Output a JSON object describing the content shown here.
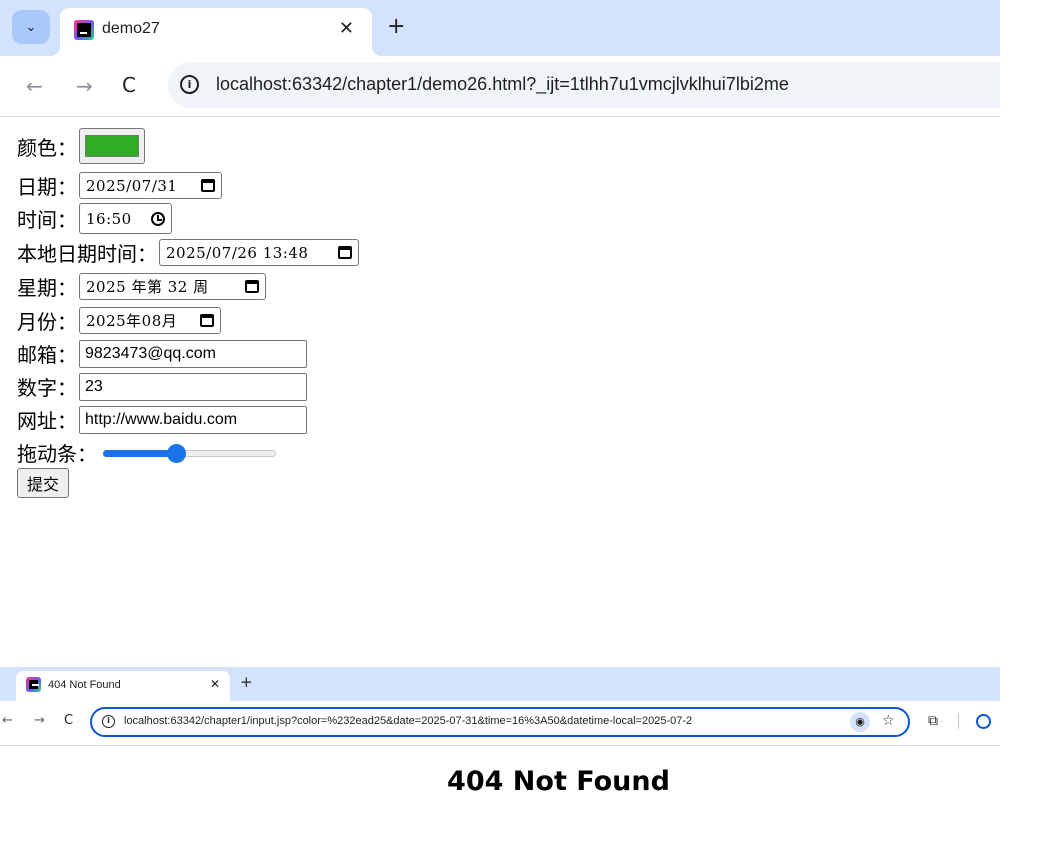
{
  "top_window": {
    "tab_title": "demo27",
    "tab_close": "✕",
    "new_tab": "+",
    "url": "localhost:63342/chapter1/demo26.html?_ijt=1tlhh7u1vmcjlvklhui7lbi2me",
    "back": "←",
    "forward": "→",
    "reload": "C",
    "dropdown": "⌄"
  },
  "form": {
    "color": {
      "label": "颜色：",
      "value": "#2ead25"
    },
    "date": {
      "label": "日期：",
      "value": "2025/07/31"
    },
    "time": {
      "label": "时间：",
      "value": "16:50"
    },
    "datetime_local": {
      "label": "本地日期时间：",
      "value": "2025/07/26 13:48"
    },
    "week": {
      "label": "星期：",
      "value": "2025 年第 32 周"
    },
    "month": {
      "label": "月份：",
      "value": "2025年08月"
    },
    "email": {
      "label": "邮箱：",
      "value": "9823473@qq.com"
    },
    "number": {
      "label": "数字：",
      "value": "23"
    },
    "url": {
      "label": "网址：",
      "value": "http://www.baidu.com"
    },
    "range": {
      "label": "拖动条：",
      "value": 0.42
    },
    "submit_label": "提交"
  },
  "bottom_window": {
    "tab_title": "404 Not Found",
    "tab_close": "✕",
    "new_tab": "+",
    "url": "localhost:63342/chapter1/input.jsp?color=%232ead25&date=2025-07-31&time=16%3A50&datetime-local=2025-07-2",
    "back": "←",
    "forward": "→",
    "reload": "C",
    "star": "☆"
  },
  "error_page": {
    "heading": "404 Not Found"
  },
  "colors": {
    "tabstrip": "#d3e3fd",
    "accent": "#1a73e8",
    "swatch": "#2ead25"
  }
}
